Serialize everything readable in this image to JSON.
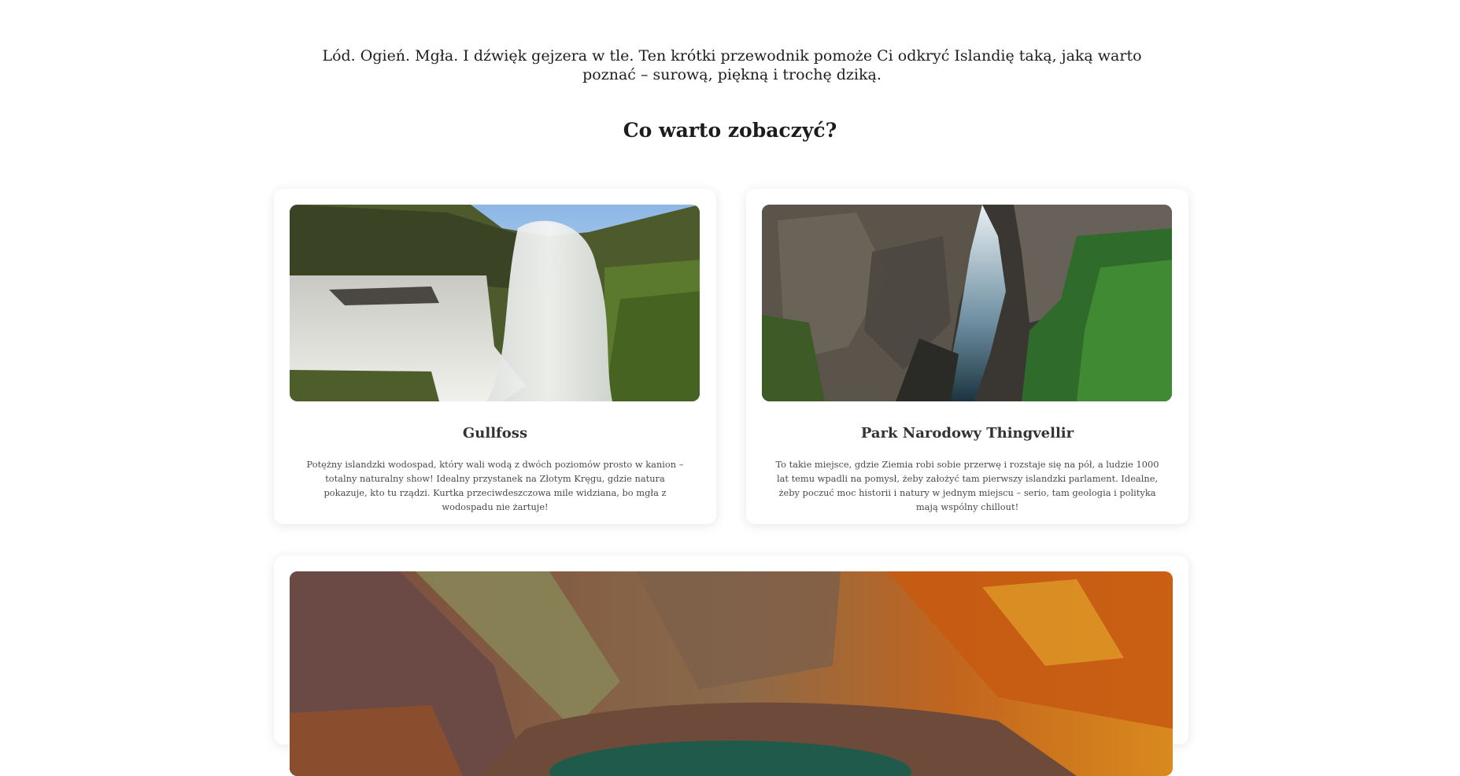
{
  "intro": {
    "text": "Lód. Ogień. Mgła. I dźwięk gejzera w tle. Ten krótki przewodnik pomoże Ci odkryć Islandię taką, jaką warto poznać – surową, piękną i trochę dziką."
  },
  "section": {
    "title": "Co warto zobaczyć?"
  },
  "cards": [
    {
      "title": "Gullfoss",
      "text": "Potężny islandzki wodospad, który wali wodą z dwóch poziomów prosto w kanion – totalny naturalny show! Idealny przystanek na Złotym Kręgu, gdzie natura pokazuje, kto tu rządzi. Kurtka przeciwdeszczowa mile widziana, bo mgła z wodospadu nie żartuje!"
    },
    {
      "title": "Park Narodowy Thingvellir",
      "text": "To takie miejsce, gdzie Ziemia robi sobie przerwę i rozstaje się na pół, a ludzie 1000 lat temu wpadli na pomysł, żeby założyć tam pierwszy islandzki parlament. Idealne, żeby poczuć moc historii i natury w jednym miejscu – serio, tam geologia i polityka mają wspólny chillout!"
    }
  ]
}
